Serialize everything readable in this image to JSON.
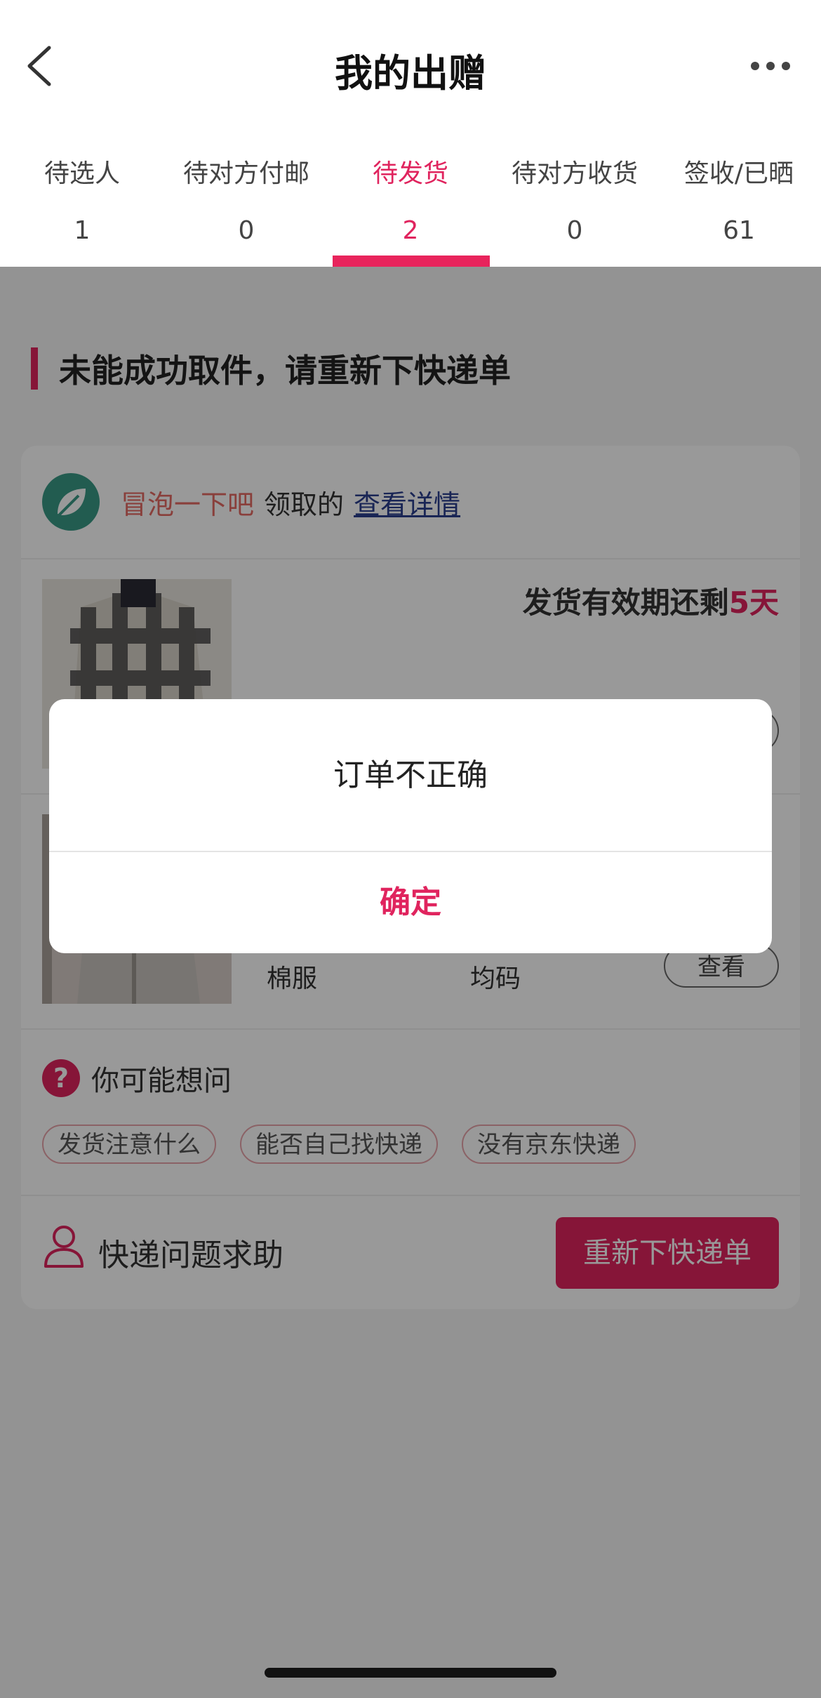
{
  "header": {
    "title": "我的出赠",
    "back_icon": "chevron-left-icon",
    "more_icon": "more-icon"
  },
  "tabs": [
    {
      "label": "待选人",
      "count": "1",
      "active": false
    },
    {
      "label": "待对方付邮",
      "count": "0",
      "active": false
    },
    {
      "label": "待发货",
      "count": "2",
      "active": true
    },
    {
      "label": "待对方收货",
      "count": "0",
      "active": false
    },
    {
      "label": "签收/已晒",
      "count": "61",
      "active": false
    }
  ],
  "section": {
    "title": "未能成功取件，请重新下快递单"
  },
  "receiver": {
    "name": "冒泡一下吧",
    "mid_text": "领取的",
    "link_text": "查看详情"
  },
  "items": [
    {
      "deadline_prefix": "发货有效期还剩",
      "deadline_value": "5天",
      "name": "",
      "size": "",
      "view_label": ""
    },
    {
      "deadline_prefix": "",
      "deadline_value": "",
      "name": "棉服",
      "size": "均码",
      "view_label": "查看"
    }
  ],
  "faq": {
    "title": "你可能想问",
    "icon_text": "?",
    "tags": [
      "发货注意什么",
      "能否自己找快递",
      "没有京东快递"
    ]
  },
  "help": {
    "text": "快递问题求助",
    "button_label": "重新下快递单"
  },
  "dialog": {
    "message": "订单不正确",
    "confirm_label": "确定"
  },
  "colors": {
    "accent": "#e0245e",
    "overlay": "rgba(0,0,0,0.4)",
    "avatar": "#3a9a86"
  }
}
